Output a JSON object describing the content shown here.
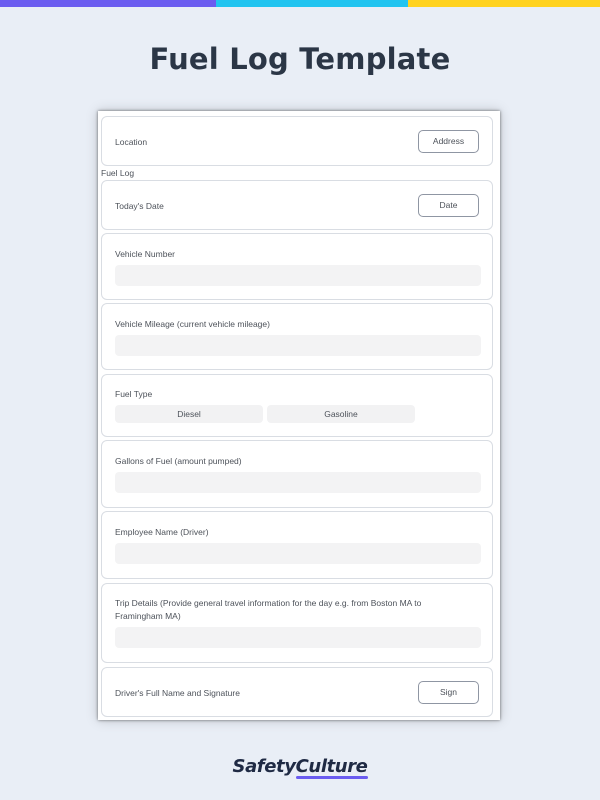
{
  "page": {
    "title": "Fuel Log Template"
  },
  "stripe_colors": [
    "#6b5cf0",
    "#21c4f0",
    "#ffd21f"
  ],
  "form": {
    "section_caption": "Fuel Log",
    "location": {
      "label": "Location",
      "button": "Address"
    },
    "date": {
      "label": "Today's Date",
      "button": "Date"
    },
    "vehicle_number": {
      "label": "Vehicle Number",
      "value": ""
    },
    "vehicle_mileage": {
      "label": "Vehicle Mileage (current vehicle mileage)",
      "value": ""
    },
    "fuel_type": {
      "label": "Fuel Type",
      "options": [
        "Diesel",
        "Gasoline"
      ]
    },
    "gallons": {
      "label": "Gallons of Fuel (amount pumped)",
      "value": ""
    },
    "employee": {
      "label": "Employee Name (Driver)",
      "value": ""
    },
    "trip_details": {
      "label": "Trip Details (Provide general travel information for the day e.g. from Boston MA to Framingham MA)",
      "value": ""
    },
    "signature": {
      "label": "Driver's Full Name and Signature",
      "button": "Sign"
    }
  },
  "brand": {
    "part1": "Safety",
    "part2": "Culture"
  }
}
